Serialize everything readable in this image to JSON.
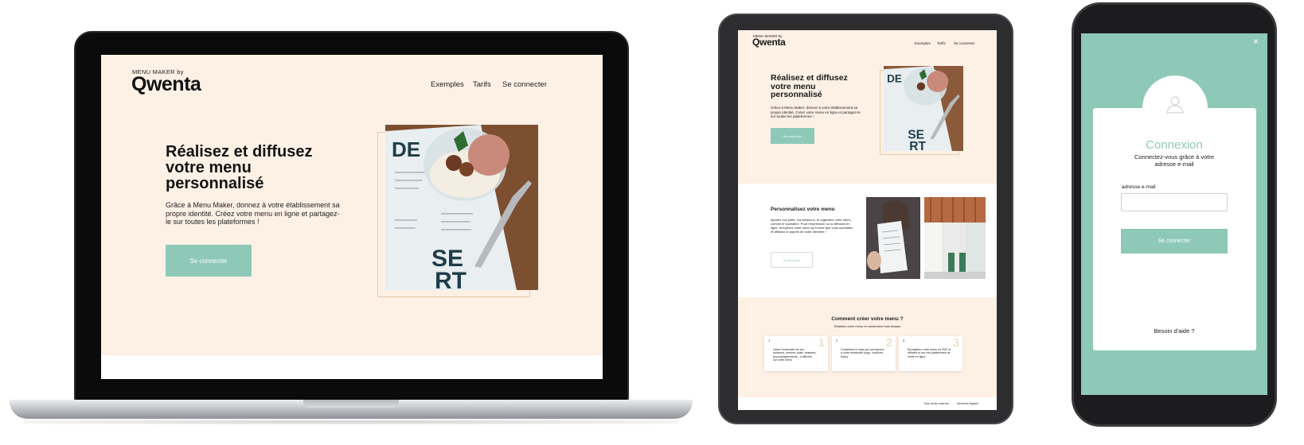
{
  "brand": {
    "small": "MENU MAKER by",
    "big": "Qwenta"
  },
  "nav": {
    "examples": "Exemples",
    "pricing": "Tarifs",
    "login": "Se connecter"
  },
  "hero": {
    "title": "Réalisez et diffusez votre menu personnalisé",
    "description": "Grâce à Menu Maker, donnez à votre établissement sa propre identité. Créez votre menu en ligne et partagez-le sur toutes les plateformes !",
    "button": "Se connecter"
  },
  "customize": {
    "title": "Personnalisez votre menu",
    "description": "Ajoutez vos plats, vos boissons, et organisez votre menu comme le souhaitez. Pour l'impression ou la diffusion en ligne, récupérez votre menu au format que vous souhaitez et diffusez-le auprès de votre clientèle !",
    "button": "Je découvre"
  },
  "how": {
    "title": "Comment créer votre menu ?",
    "subtitle": "Réalisez votre menu en seulement trois étapes",
    "steps": [
      {
        "n": "1",
        "text": "Listez l'ensemble de vos boissons, entrées, plats, desserts, accompagnements... à afficher sur votre menu"
      },
      {
        "n": "2",
        "text": "Choisissez le style qui correspond à votre restaurant (logo, couleurs, fonts)"
      },
      {
        "n": "3",
        "text": "Enregistrez votre menu en PDF et diffusez-le sur vos plateformes de vente en ligne"
      }
    ]
  },
  "footer": {
    "rights": "Tous droits réservés",
    "legal": "Mentions légales"
  },
  "login": {
    "close": "×",
    "title": "Connexion",
    "subtitle": "Connectez-vous grâce à votre adresse e-mail",
    "email_label": "adresse e-mail",
    "email_value": "",
    "button": "Se connecter",
    "help": "Besoin d'aide ?"
  },
  "colors": {
    "accent": "#8ec9b8",
    "cream": "#fdf1e6",
    "frame": "#e8c9a5"
  },
  "icons": [
    "close-icon",
    "user-icon"
  ]
}
